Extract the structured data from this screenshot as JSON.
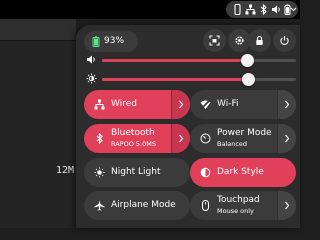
{
  "background_window": {
    "text_fragment": "12M"
  },
  "status_bar": {
    "icons": [
      "phone-icon",
      "network-wired-icon",
      "bluetooth-icon",
      "volume-icon",
      "battery-icon",
      "chevron-down-icon"
    ]
  },
  "battery": {
    "percentage": "93%"
  },
  "header_buttons": [
    "screenshot-icon",
    "settings-gear-icon",
    "lock-icon",
    "power-icon"
  ],
  "sliders": {
    "volume": {
      "level": 0.75
    },
    "brightness": {
      "level": 0.76
    }
  },
  "tiles": {
    "wired": {
      "label": "Wired",
      "active": true
    },
    "wifi": {
      "label": "Wi-Fi",
      "active": false
    },
    "bluetooth": {
      "label": "Bluetooth",
      "subtitle": "RAPOO 5.0MS",
      "active": true
    },
    "power_mode": {
      "label": "Power Mode",
      "subtitle": "Balanced",
      "active": false
    },
    "night_light": {
      "label": "Night Light",
      "active": false
    },
    "dark_style": {
      "label": "Dark Style",
      "active": true
    },
    "airplane_mode": {
      "label": "Airplane Mode",
      "active": false
    },
    "touchpad": {
      "label": "Touchpad",
      "subtitle": "Mouse only",
      "active": false
    }
  },
  "colors": {
    "accent": "#e0405a",
    "tile_inactive": "#3b3b3b",
    "panel": "#2c2c2c"
  }
}
